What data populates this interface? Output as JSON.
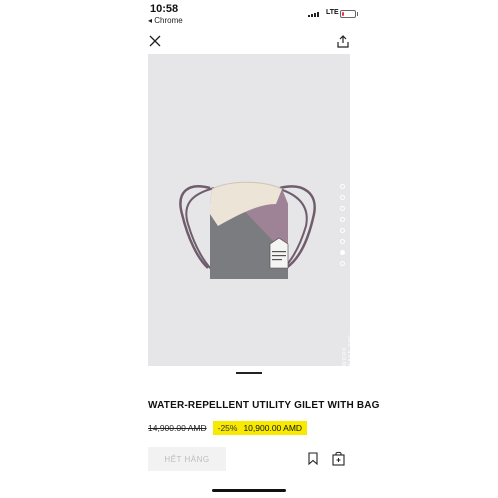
{
  "status_bar": {
    "time": "10:58",
    "back_app": "◂ Chrome",
    "network": "LTE"
  },
  "product": {
    "title": "WATER-REPELLENT UTILITY GILET WITH BAG",
    "old_price": "14,900.00 AMD",
    "discount": "-25%",
    "new_price": "10,900.00 AMD",
    "sold_out_label": "HẾT HÀNG",
    "image_side_text": "WORK SAFE THE WORLD",
    "carousel_dots": 8,
    "carousel_active": 7
  },
  "colors": {
    "highlight": "#f7e900",
    "image_bg": "#e6e5e7",
    "bag_grey": "#7b7c80",
    "bag_mauve": "#9e8396",
    "bag_cream": "#ece4d6",
    "cord": "#6f5d6d"
  },
  "icons": {
    "close": "close-icon",
    "share": "share-icon",
    "bookmark": "bookmark-icon",
    "bag": "shopping-bag-icon"
  }
}
